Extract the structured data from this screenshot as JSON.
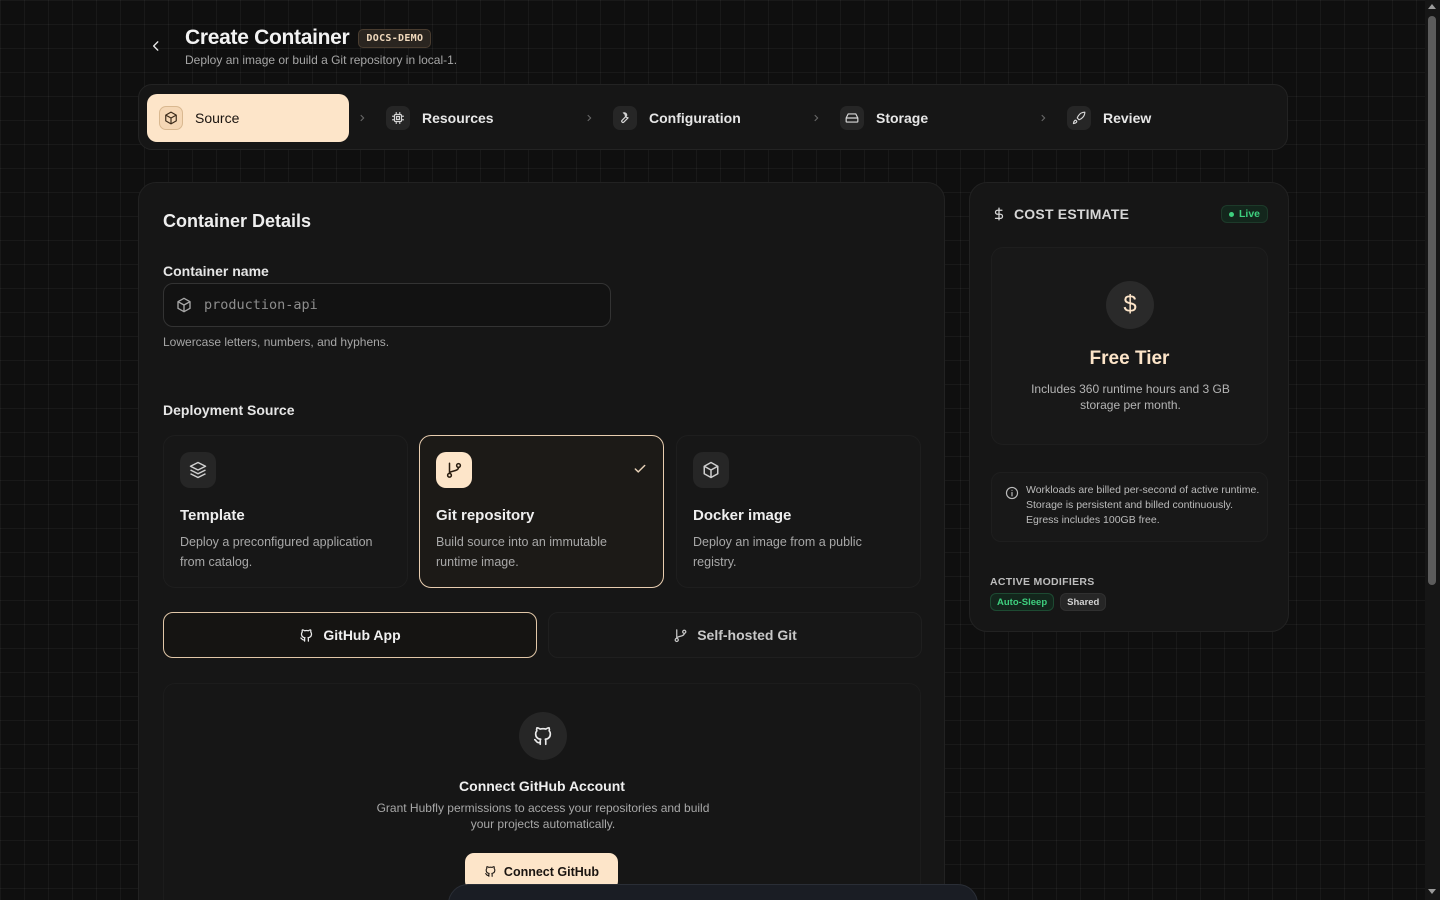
{
  "header": {
    "title": "Create Container",
    "badge": "DOCS-DEMO",
    "subtitle": "Deploy an image or build a Git repository in local-1."
  },
  "stepper": {
    "steps": [
      {
        "label": "Source",
        "icon": "package-icon",
        "active": true
      },
      {
        "label": "Resources",
        "icon": "cpu-icon",
        "active": false
      },
      {
        "label": "Configuration",
        "icon": "wrench-icon",
        "active": false
      },
      {
        "label": "Storage",
        "icon": "hard-drive-icon",
        "active": false
      },
      {
        "label": "Review",
        "icon": "rocket-icon",
        "active": false
      }
    ]
  },
  "details": {
    "title": "Container Details",
    "name_label": "Container name",
    "name_placeholder": "production-api",
    "name_help": "Lowercase letters, numbers, and hyphens.",
    "source_label": "Deployment Source",
    "sources": [
      {
        "title": "Template",
        "desc": "Deploy a preconfigured application from catalog.",
        "icon": "layers-icon",
        "selected": false
      },
      {
        "title": "Git repository",
        "desc": "Build source into an immutable runtime image.",
        "icon": "git-branch-icon",
        "selected": true
      },
      {
        "title": "Docker image",
        "desc": "Deploy an image from a public registry.",
        "icon": "package-icon",
        "selected": false
      }
    ],
    "providers": [
      {
        "label": "GitHub App",
        "icon": "github-icon",
        "active": true
      },
      {
        "label": "Self-hosted Git",
        "icon": "git-branch-icon",
        "active": false
      }
    ],
    "connect": {
      "title": "Connect GitHub Account",
      "desc": "Grant Hubfly permissions to access your repositories and build your projects automatically.",
      "button": "Connect GitHub"
    }
  },
  "cost": {
    "title": "COST ESTIMATE",
    "live": "Live",
    "tier_symbol": "$",
    "tier": "Free Tier",
    "tier_desc": "Includes 360 runtime hours and 3 GB storage per month.",
    "info": "Workloads are billed per-second of active runtime. Storage is persistent and billed continuously. Egress includes 100GB free.",
    "modifiers_label": "ACTIVE MODIFIERS",
    "modifiers": [
      "Auto-Sleep",
      "Shared"
    ]
  },
  "colors": {
    "accent": "#fde5c9",
    "live_green": "#3ecf7e",
    "background": "#0f0f0f"
  }
}
